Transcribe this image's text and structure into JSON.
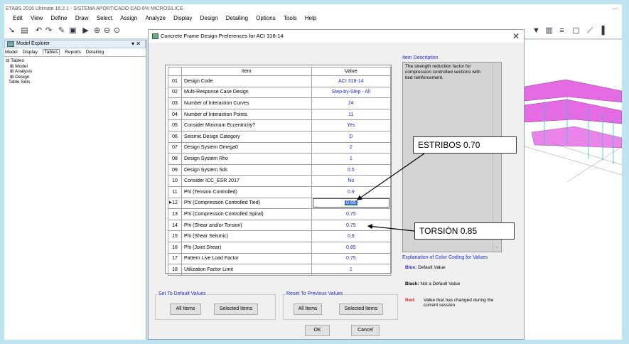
{
  "window": {
    "title": "ETABS 2016 Ultimate 16.2.1 - SISTEMA APORTICADO CAD 6% MICROSILICE",
    "minimize": "—"
  },
  "menu": [
    "Edit",
    "View",
    "Define",
    "Draw",
    "Select",
    "Assign",
    "Analyze",
    "Display",
    "Design",
    "Detailing",
    "Options",
    "Tools",
    "Help"
  ],
  "explorer": {
    "title": "Model Explorer",
    "controls": "▾ ✕",
    "tabs": [
      "Model",
      "Display",
      "Tables",
      "Reports",
      "Detailing"
    ],
    "tree": [
      "⊟ Tables",
      "  ⊞ Model",
      "  ⊞ Analysis",
      "  ⊞ Design",
      "Table Sets"
    ]
  },
  "dialog": {
    "title": "Concrete Frame Design Preferences for ACI 318-14",
    "close": "✕",
    "columns": {
      "item": "Item",
      "value": "Value"
    },
    "rows": [
      {
        "n": "01",
        "item": "Design Code",
        "value": "ACI 318-14"
      },
      {
        "n": "02",
        "item": "Multi-Response Case Design",
        "value": "Step-by-Step - All"
      },
      {
        "n": "03",
        "item": "Number of Interaction Curves",
        "value": "24"
      },
      {
        "n": "04",
        "item": "Number of Interaction Points",
        "value": "11"
      },
      {
        "n": "05",
        "item": "Consider Minimum Eccentricity?",
        "value": "Yes"
      },
      {
        "n": "06",
        "item": "Seismic Design Category",
        "value": "D"
      },
      {
        "n": "07",
        "item": "Design System Omega0",
        "value": "2"
      },
      {
        "n": "08",
        "item": "Design System Rho",
        "value": "1"
      },
      {
        "n": "09",
        "item": "Design System Sds",
        "value": "0.5"
      },
      {
        "n": "10",
        "item": "Consider ICC_ESR 2017",
        "value": "No"
      },
      {
        "n": "11",
        "item": "Phi (Tension Controlled)",
        "value": "0.9"
      },
      {
        "n": "12",
        "item": "Phi (Compression Controlled Tied)",
        "value": "0.65"
      },
      {
        "n": "13",
        "item": "Phi (Compression Controlled Spiral)",
        "value": "0.75"
      },
      {
        "n": "14",
        "item": "Phi (Shear and/or Torsion)",
        "value": "0.75"
      },
      {
        "n": "15",
        "item": "Phi (Shear Seismic)",
        "value": "0.6"
      },
      {
        "n": "16",
        "item": "Phi (Joint Shear)",
        "value": "0.85"
      },
      {
        "n": "17",
        "item": "Pattern Live Load Factor",
        "value": "0.75"
      },
      {
        "n": "18",
        "item": "Utilization Factor Limit",
        "value": "1"
      }
    ],
    "description": {
      "label": "Item Description",
      "text": "The strength reduction factor for compression controlled sections with tied reinforcement."
    },
    "legend": {
      "title": "Explanation of Color Coding for Values",
      "blue_key": "Blue:",
      "blue_text": "Default Value",
      "black_key": "Black:",
      "black_text": "Not a Default Value",
      "red_key": "Red:",
      "red_text": "Value that has changed during the current session"
    },
    "set_default": {
      "label": "Set To Default Values",
      "all": "All Items",
      "selected": "Selected Items"
    },
    "reset_previous": {
      "label": "Reset To Previous Values",
      "all": "All Items",
      "selected": "Selected Items"
    },
    "ok": "OK",
    "cancel": "Cancel"
  },
  "callouts": {
    "estribos": "ESTRIBOS 0.70",
    "torsion": "TORSIÓN 0.85"
  },
  "colors": {
    "blue": "#1c2fd4",
    "red": "#e02020",
    "selection": "#3370d0",
    "model": "#e35be3"
  }
}
